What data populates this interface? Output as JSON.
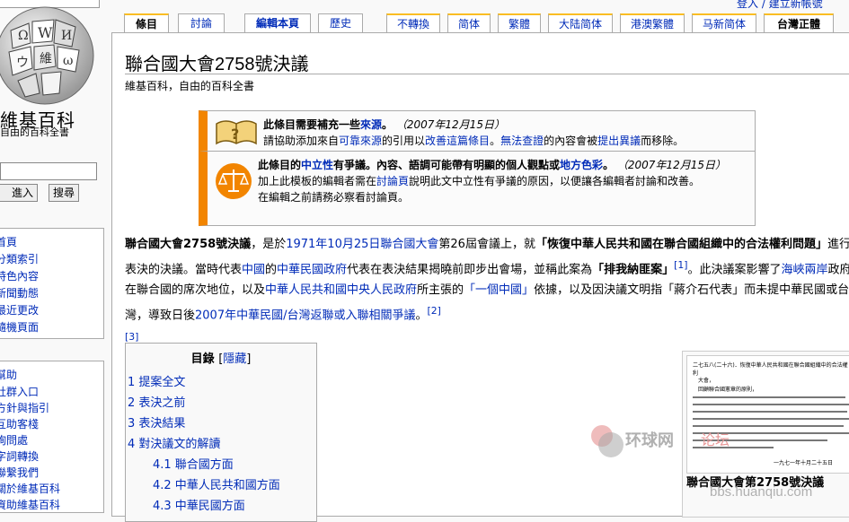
{
  "header": {
    "userlink": "登入 / 建立新帳號"
  },
  "tabs": [
    {
      "label": "條目"
    },
    {
      "label": "討論"
    },
    {
      "label": "編輯本頁"
    },
    {
      "label": "歷史"
    },
    {
      "label": "不轉換"
    },
    {
      "label": "简体"
    },
    {
      "label": "繁體"
    },
    {
      "label": "大陆简体"
    },
    {
      "label": "港澳繁體"
    },
    {
      "label": "马新简体"
    },
    {
      "label": "台灣正體"
    }
  ],
  "logo": {
    "title": "維基百科",
    "subtitle": "自由的百科全書"
  },
  "search": {
    "go_label": "進入",
    "search_label": "搜尋"
  },
  "sidebar": {
    "nav": [
      "首頁",
      "分類索引",
      "特色內容",
      "新聞動態",
      "最近更改",
      "隨機頁面"
    ],
    "interaction": [
      "幫助",
      "社群入口",
      "方針與指引",
      "互助客棧",
      "詢問處",
      "字詞轉換",
      "聯繫我們",
      "關於維基百科",
      "資助維基百科"
    ]
  },
  "article": {
    "title": "聯合國大會2758號決議",
    "sitesub": "維基百科，自由的百科全書"
  },
  "ambox1": {
    "bold_a": "此條目需要補充一些",
    "bold_link": "來源",
    "bold_end": "。",
    "date": "（2007年12月15日）",
    "l2_a": "請協助添加來自",
    "l2_b": "可靠來源",
    "l2_c": "的引用以",
    "l2_d": "改善這篇條目",
    "l2_e": "。",
    "l2_f": "無法查證",
    "l2_g": "的內容會被",
    "l2_h": "提出異議",
    "l2_i": "而移除。"
  },
  "ambox2": {
    "b1": "此條目的",
    "b_link1": "中立性",
    "b2": "有爭議。內容、語調可能帶有明顯的個人觀點或",
    "b_link2": "地方色彩",
    "b3": "。",
    "date": "（2007年12月15日）",
    "l2_a": "加上此模板的編輯者需在",
    "l2_link": "討論頁",
    "l2_b": "說明此文中立性有爭議的原因，以便讓各編輯者討論和改善。",
    "l3": "在編輯之前請務必察看討論頁。"
  },
  "intro": {
    "t1": "聯合國大會2758號決議",
    "t2": "，是於",
    "t3": "1971年",
    "t4": "10月25日",
    "t5": "聯合國大會",
    "t6": "第26屆會議上，就",
    "t7": "「恢復中華人民共和國在聯合國組織中的合法權利問題」",
    "t8": "進行表決的決議。當時代表",
    "t9": "中國",
    "t10": "的",
    "t11": "中華民國政府",
    "t12": "代表在表決結果揭曉前即步出會場，並稱此案為",
    "t13": "「排我納匪案」",
    "t14": "[1]",
    "t15": "。此決議案影響了",
    "t16": "海峽兩岸",
    "t17": "政府在聯合國的席次地位，以及",
    "t18": "中華人民共和國中央人民政府",
    "t19": "所主張的",
    "t20": "「一個中國」",
    "t21": "依據，以及因決議文明指「蔣介石代表」而未提中華民國或台灣，導致日後",
    "t22": "2007年中華民國/台灣返聯或入聯相關爭議",
    "t23": "。",
    "t24": "[2]",
    "t25": "[3]"
  },
  "toc": {
    "title": "目錄",
    "hide_open": "[",
    "hide": "隱藏",
    "hide_close": "]",
    "items": [
      "1 提案全文",
      "2 表決之前",
      "3 表決結果",
      "4 對決議文的解讀",
      "4.1 聯合國方面",
      "4.2 中華人民共和國方面",
      "4.3 中華民國方面"
    ]
  },
  "thumb": {
    "caption": "聯合國大會第2758號決議",
    "doc_header": "二七五八(二十六)．恢復中華人民共和國在聯合國組織中的合法權利",
    "doc_sub": "大會，",
    "doc_line1": "回顧聯合國憲章的原則，",
    "doc_date": "一九七一年十月二十五日"
  },
  "watermark": {
    "brand": "环球网",
    "tag": "论坛",
    "url": "bbs.huanqiu.com"
  },
  "colors": {
    "link": "#002bb8",
    "ambox_border": "#f28500",
    "tab_accent": "#fabd23"
  }
}
